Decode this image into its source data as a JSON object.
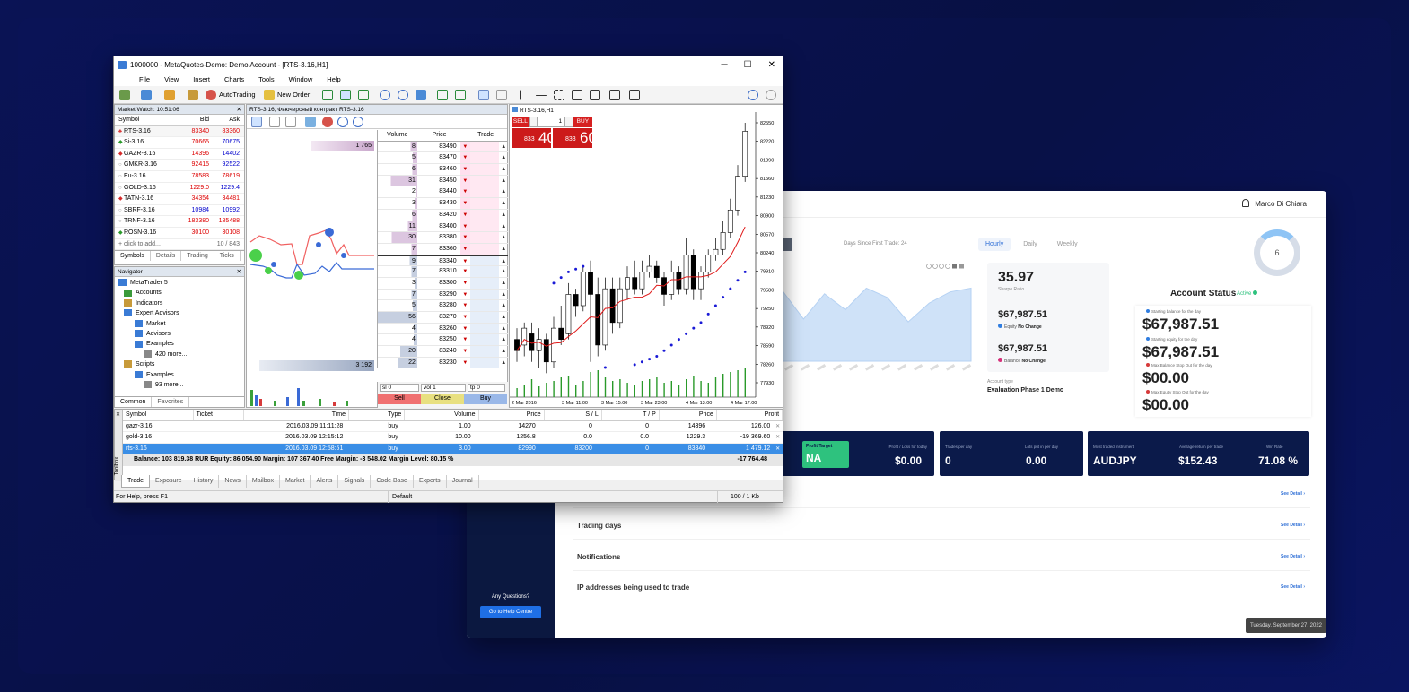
{
  "mt5": {
    "title": "1000000 - MetaQuotes-Demo: Demo Account - [RTS-3.16,H1]",
    "menu": [
      "File",
      "View",
      "Insert",
      "Charts",
      "Tools",
      "Window",
      "Help"
    ],
    "toolbar": {
      "autotrading": "AutoTrading",
      "new_order": "New Order"
    },
    "market_watch": {
      "header": "Market Watch: 10:51:06",
      "cols": {
        "symbol": "Symbol",
        "bid": "Bid",
        "ask": "Ask"
      },
      "rows": [
        {
          "symbol": "RTS-3.16",
          "bid": "83340",
          "ask": "83360"
        },
        {
          "symbol": "Si-3.16",
          "bid": "70665",
          "ask": "70675"
        },
        {
          "symbol": "GAZR-3.16",
          "bid": "14396",
          "ask": "14402"
        },
        {
          "symbol": "GMKR-3.16",
          "bid": "92415",
          "ask": "92522"
        },
        {
          "symbol": "Eu-3.16",
          "bid": "78583",
          "ask": "78619"
        },
        {
          "symbol": "GOLD-3.16",
          "bid": "1229.0",
          "ask": "1229.4"
        },
        {
          "symbol": "TATN-3.16",
          "bid": "34354",
          "ask": "34481"
        },
        {
          "symbol": "SBRF-3.16",
          "bid": "10984",
          "ask": "10992"
        },
        {
          "symbol": "TRNF-3.16",
          "bid": "183380",
          "ask": "185488"
        },
        {
          "symbol": "ROSN-3.16",
          "bid": "30100",
          "ask": "30108"
        }
      ],
      "add": "+ click to add...",
      "count": "10 / 843",
      "tabs": [
        "Symbols",
        "Details",
        "Trading",
        "Ticks"
      ]
    },
    "navigator": {
      "header": "Navigator",
      "items": [
        "MetaTrader 5",
        "Accounts",
        "Indicators",
        "Expert Advisors",
        "Market",
        "Advisors",
        "Examples",
        "420 more...",
        "Scripts",
        "Examples",
        "93 more..."
      ],
      "tabs": [
        "Common",
        "Favorites"
      ]
    },
    "dom": {
      "header": "RTS-3.16, Фьючерсный контракт RTS-3.16",
      "cols": {
        "volume": "Volume",
        "price": "Price",
        "trade": "Trade"
      },
      "left_bars": [
        "1 765",
        "3 192"
      ],
      "rows": [
        {
          "v": "8",
          "p": "83490"
        },
        {
          "v": "5",
          "p": "83470"
        },
        {
          "v": "6",
          "p": "83460"
        },
        {
          "v": "31",
          "p": "83450"
        },
        {
          "v": "2",
          "p": "83440"
        },
        {
          "v": "3",
          "p": "83430"
        },
        {
          "v": "6",
          "p": "83420"
        },
        {
          "v": "11",
          "p": "83400"
        },
        {
          "v": "30",
          "p": "83380"
        },
        {
          "v": "7",
          "p": "83360"
        },
        {
          "v": "9",
          "p": "83340"
        },
        {
          "v": "7",
          "p": "83310"
        },
        {
          "v": "3",
          "p": "83300"
        },
        {
          "v": "7",
          "p": "83290"
        },
        {
          "v": "5",
          "p": "83280"
        },
        {
          "v": "56",
          "p": "83270"
        },
        {
          "v": "4",
          "p": "83260"
        },
        {
          "v": "4",
          "p": "83250"
        },
        {
          "v": "20",
          "p": "83240"
        },
        {
          "v": "22",
          "p": "83230"
        }
      ],
      "sl": "sl",
      "sl_val": "0",
      "vol": "vol",
      "vol_val": "1",
      "tp": "tp",
      "tp_val": "0",
      "sell": "Sell",
      "close": "Close",
      "buy": "Buy"
    },
    "chart": {
      "header": "RTS-3.16,H1",
      "sell": "SELL",
      "buy": "BUY",
      "lot": "1",
      "sell_small": "833",
      "sell_big": "40",
      "buy_small": "833",
      "buy_big": "60",
      "yticks": [
        "82550",
        "82220",
        "81890",
        "81560",
        "81230",
        "80900",
        "80570",
        "80240",
        "79910",
        "79580",
        "79250",
        "78920",
        "78590",
        "78260",
        "77930"
      ],
      "xticks": [
        "2 Mar 2016",
        "3 Mar 11:00",
        "3 Mar 15:00",
        "3 Mar 23:00",
        "4 Mar 13:00",
        "4 Mar 17:00"
      ]
    },
    "trade": {
      "cols": [
        "Symbol",
        "Ticket",
        "Time",
        "Type",
        "Volume",
        "Price",
        "S / L",
        "T / P",
        "Price",
        "Profit"
      ],
      "rows": [
        [
          "gazr-3.16",
          "",
          "2016.03.09 11:11:28",
          "buy",
          "1.00",
          "14270",
          "0",
          "0",
          "14396",
          "126.00"
        ],
        [
          "gold-3.16",
          "",
          "2016.03.09 12:15:12",
          "buy",
          "10.00",
          "1256.8",
          "0.0",
          "0.0",
          "1229.3",
          "-19 369.60"
        ],
        [
          "rts-3.16",
          "",
          "2016.03.09 12:58:51",
          "buy",
          "3.00",
          "82990",
          "83200",
          "0",
          "83340",
          "1 479.12"
        ]
      ],
      "balance": "Balance: 103 819.38 RUR  Equity: 86 054.90  Margin: 107 367.40  Free Margin: -3 548.02  Margin Level: 80.15 %",
      "total": "-17 764.48",
      "tabs": [
        "Trade",
        "Exposure",
        "History",
        "News",
        "Mailbox",
        "Market",
        "Alerts",
        "Signals",
        "Code Base",
        "Experts",
        "Journal"
      ],
      "mailbox_badge": "4",
      "toolbox": "Toolbox"
    },
    "status": {
      "help": "For Help, press F1",
      "profile": "Default",
      "traffic": "100 / 1 Kb"
    }
  },
  "dashboard": {
    "user": "Marco Di Chiara",
    "days_since": "Days Since First Trade: 24",
    "period_tabs": [
      "Hourly",
      "Daily",
      "Weekly"
    ],
    "ring_value": "6",
    "sharpe": "35.97",
    "sharpe_label": "Sharpe Ratio",
    "equity": "$67,987.51",
    "equity_label": "Equity",
    "equity_change": "No Change",
    "balance": "$67,987.51",
    "balance_label": "Balance",
    "balance_change": "No Change",
    "account_type_label": "Account type",
    "account_type": "Evaluation Phase 1 Demo",
    "status_title": "Account Status",
    "status_value": "Active",
    "status_rows": [
      {
        "label": "Starting balance for the day",
        "value": "$67,987.51"
      },
      {
        "label": "Starting equity for the day",
        "value": "$67,987.51"
      },
      {
        "label": "Max Balance Stop Out for the day",
        "value": "$00.00"
      },
      {
        "label": "Max Equity Stop Out for the day",
        "value": "$00.00"
      }
    ],
    "kpis": [
      {
        "label": "Profit Target",
        "value": "NA"
      },
      {
        "label": "Profit / Loss for today",
        "value": "$0.00"
      },
      {
        "label": "Trades per day",
        "value": "0"
      },
      {
        "label": "Lots put in per day",
        "value": "0.00"
      },
      {
        "label": "Most traded instrument",
        "value": "AUDJPY"
      },
      {
        "label": "Average return per trade",
        "value": "$152.43"
      },
      {
        "label": "Win Rate",
        "value": "71.08 %"
      }
    ],
    "see_detail": "See Detail ›",
    "sections": [
      "Trading days",
      "Notifications",
      "IP addresses being used to trade"
    ],
    "help_q": "Any Questions?",
    "help_btn": "Go to Help Centre",
    "date": "Tuesday, September 27, 2022",
    "area_values": [
      0.75,
      0.45,
      0.72,
      0.55,
      0.78,
      0.68,
      0.42,
      0.62,
      0.74,
      0.78
    ]
  }
}
